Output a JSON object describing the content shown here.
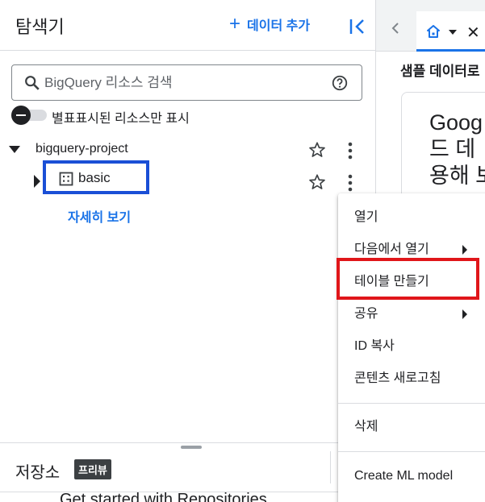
{
  "explorer": {
    "title": "탐색기",
    "add_data_label": "데이터 추가",
    "search": {
      "placeholder": "BigQuery 리소스 검색"
    },
    "starred_only_toggle": {
      "label": "별표표시된 리소스만 표시",
      "on": false
    },
    "tree": {
      "project": {
        "name": "bigquery-project",
        "expanded": true
      },
      "dataset": {
        "name": "basic",
        "expanded": false,
        "selected": true
      },
      "details_link": "자세히 보기"
    }
  },
  "repositories": {
    "title": "저장소",
    "badge": "프리뷰",
    "started_text": "Get started with Repositories"
  },
  "main": {
    "section_title": "샘플 데이터로",
    "card_text": "Goog\n드 데\n용해 보"
  },
  "context_menu": {
    "items": [
      {
        "label": "열기",
        "submenu": false
      },
      {
        "label": "다음에서 열기",
        "submenu": true
      },
      {
        "label": "테이블 만들기",
        "submenu": false,
        "highlighted": true
      },
      {
        "label": "공유",
        "submenu": true
      },
      {
        "label": "ID 복사",
        "submenu": false
      },
      {
        "label": "콘텐츠 새로고침",
        "submenu": false
      },
      {
        "label": "삭제",
        "submenu": false
      },
      {
        "label": "Create ML model",
        "submenu": false
      }
    ]
  },
  "colors": {
    "accent": "#1a73e8",
    "dataset_highlight": "#1a4fd6",
    "menu_highlight": "#e0161a"
  },
  "icons": {
    "search": "search-icon",
    "help": "help-icon",
    "star": "star-icon",
    "more": "kebab-icon",
    "dataset": "dataset-icon",
    "home": "home-icon",
    "collapse": "collapse-panel-icon"
  }
}
